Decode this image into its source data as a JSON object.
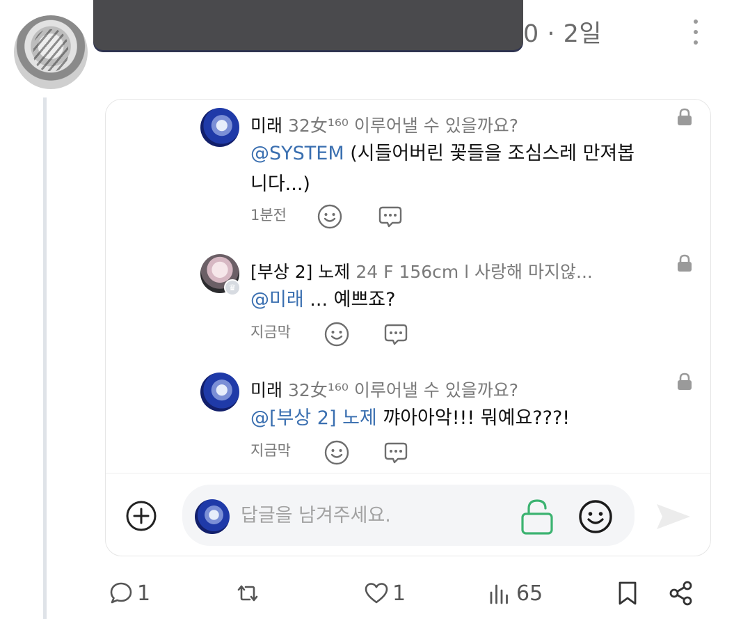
{
  "post": {
    "time": "0 · 2일",
    "avatar_icon": "anime-character-avatar",
    "menu_icon": "kebab-menu-icon"
  },
  "comments": [
    {
      "name": "미래",
      "subtitle": "32女¹⁶⁰ 이루어낼 수 있을까요?",
      "mention": "@SYSTEM",
      "text": "(시들어버린 꽃들을 조심스레 만져봅니다...)",
      "time": "1분전",
      "locked": true
    },
    {
      "name": "[부상 2] 노제",
      "subtitle": "24 F 156cm l 사랑해 마지않...",
      "mention": "@미래",
      "text": "... 예쁘죠?",
      "time": "지금막",
      "locked": true
    },
    {
      "name": "미래",
      "subtitle": "32女¹⁶⁰ 이루어낼 수 있을까요?",
      "mention": "@[부상 2] 노제",
      "text": "꺄아아악!!! 뭐예요???!",
      "time": "지금막",
      "locked": true
    }
  ],
  "reply": {
    "placeholder": "답글을 남겨주세요."
  },
  "actions": {
    "replies": "1",
    "reposts": "",
    "likes": "1",
    "views": "65"
  },
  "colors": {
    "mention": "#3a6fb0",
    "lock_active": "#3cb371",
    "icon_gray": "#6e6e6e"
  }
}
